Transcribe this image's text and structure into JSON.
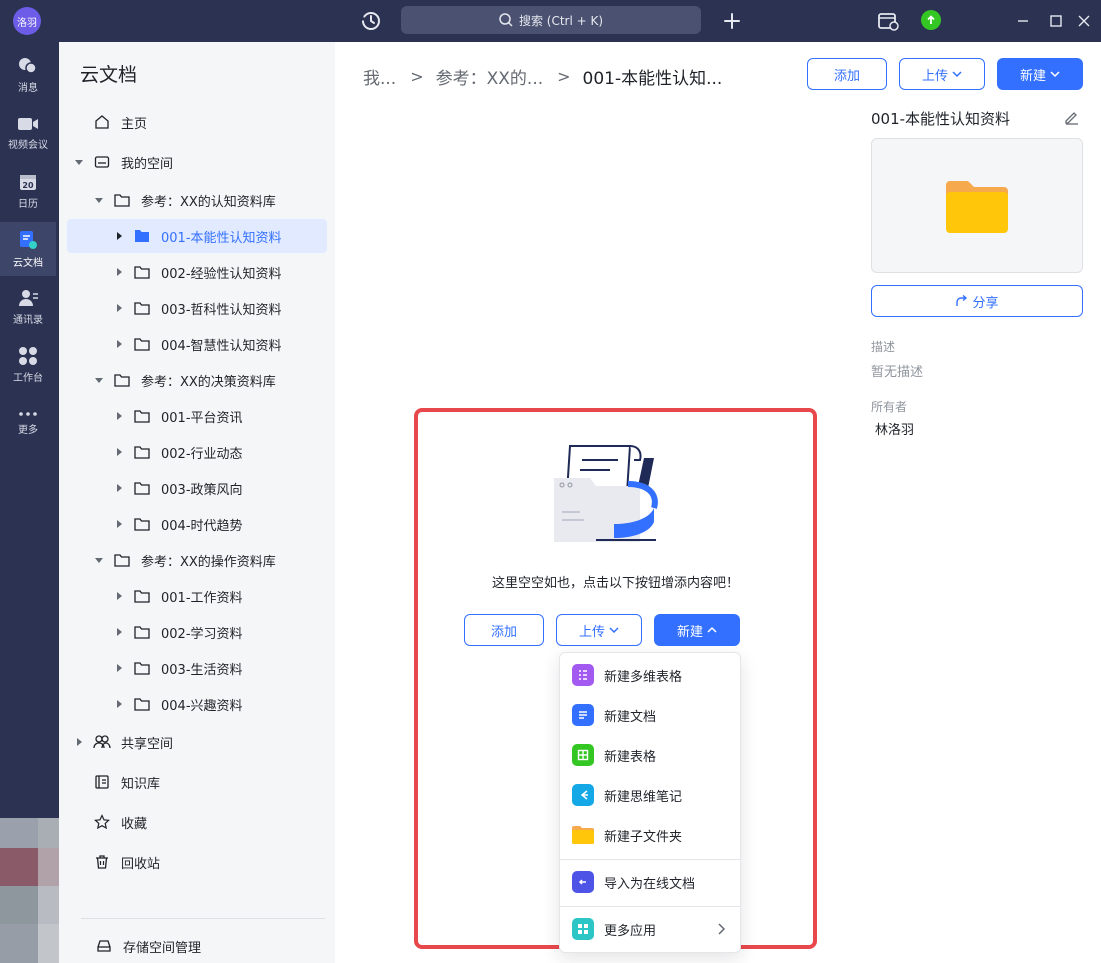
{
  "app": {
    "user_avatar": "洛羽",
    "search_label": "搜索 (Ctrl + K)"
  },
  "rail": [
    {
      "label": "消息",
      "icon": "chat-icon"
    },
    {
      "label": "视频会议",
      "icon": "video-icon"
    },
    {
      "label": "日历",
      "icon": "calendar-icon",
      "day": "20"
    },
    {
      "label": "云文档",
      "icon": "cloud-doc-icon",
      "active": true
    },
    {
      "label": "通讯录",
      "icon": "contacts-icon"
    },
    {
      "label": "工作台",
      "icon": "workbench-icon"
    },
    {
      "label": "更多",
      "icon": "more-icon"
    }
  ],
  "sidebar": {
    "title": "云文档",
    "items": [
      {
        "label": "主页"
      },
      {
        "label": "我的空间"
      },
      {
        "label": "参考：XX的认知资料库"
      },
      {
        "label": "001-本能性认知资料"
      },
      {
        "label": "002-经验性认知资料"
      },
      {
        "label": "003-哲科性认知资料"
      },
      {
        "label": "004-智慧性认知资料"
      },
      {
        "label": "参考：XX的决策资料库"
      },
      {
        "label": "001-平台资讯"
      },
      {
        "label": "002-行业动态"
      },
      {
        "label": "003-政策风向"
      },
      {
        "label": "004-时代趋势"
      },
      {
        "label": "参考：XX的操作资料库"
      },
      {
        "label": "001-工作资料"
      },
      {
        "label": "002-学习资料"
      },
      {
        "label": "003-生活资料"
      },
      {
        "label": "004-兴趣资料"
      },
      {
        "label": "共享空间"
      },
      {
        "label": "知识库"
      },
      {
        "label": "收藏"
      },
      {
        "label": "回收站"
      }
    ],
    "storage_label": "存储空间管理"
  },
  "breadcrumb": {
    "items": [
      "我...",
      "参考：XX的...",
      "001-本能性认知..."
    ]
  },
  "header_buttons": {
    "add": "添加",
    "upload": "上传",
    "new": "新建"
  },
  "detail": {
    "title": "001-本能性认知资料",
    "share": "分享",
    "desc_label": "描述",
    "desc_value": "暂无描述",
    "owner_label": "所有者",
    "owner_value": "林洛羽"
  },
  "empty": {
    "message": "这里空空如也，点击以下按钮增添内容吧！",
    "add": "添加",
    "upload": "上传",
    "new": "新建"
  },
  "dropdown": {
    "items": [
      {
        "label": "新建多维表格",
        "color": "#a25af0"
      },
      {
        "label": "新建文档",
        "color": "#3370ff"
      },
      {
        "label": "新建表格",
        "color": "#34c724"
      },
      {
        "label": "新建思维笔记",
        "color": "#14a9e6"
      },
      {
        "label": "新建子文件夹",
        "color": "#ffc60a"
      },
      {
        "label": "导入为在线文档",
        "color": "#4e55e6"
      },
      {
        "label": "更多应用",
        "color": "#2dc6c6"
      }
    ]
  }
}
